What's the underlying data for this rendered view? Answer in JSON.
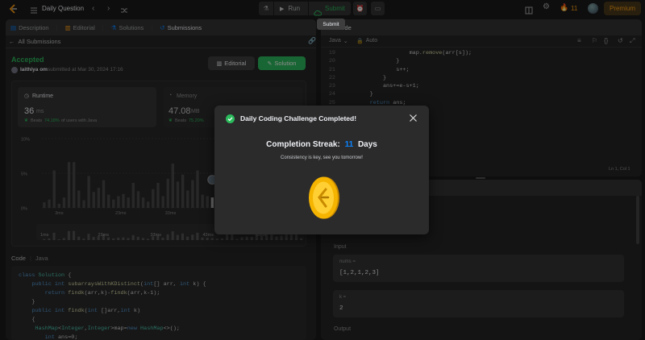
{
  "topbar": {
    "problem_list_label": "Daily Question",
    "run_label": "Run",
    "submit_label": "Submit",
    "streak_count": "11",
    "premium_label": "Premium",
    "tooltip": "Submit"
  },
  "left_tabs": [
    "Description",
    "Editorial",
    "Solutions",
    "Submissions"
  ],
  "submission": {
    "back_label": "All Submissions",
    "status": "Accepted",
    "user": "laithiya om",
    "submitted_text": "submitted at Mar 30, 2024 17:16",
    "editorial_btn": "Editorial",
    "solution_btn": "Solution",
    "runtime_label": "Runtime",
    "runtime_value": "36",
    "runtime_unit": "ms",
    "runtime_beats_prefix": "Beats",
    "runtime_beats_pct": "74.18%",
    "runtime_beats_suffix": "of users with Java",
    "memory_label": "Memory",
    "memory_value": "47.08",
    "memory_unit": "MB",
    "memory_beats_prefix": "Beats",
    "memory_beats_pct": "75.20%"
  },
  "chart_data": {
    "type": "bar",
    "ylabel_ticks": [
      "10%",
      "5%",
      "0%"
    ],
    "ylim": [
      0,
      10
    ],
    "x_ticks": [
      "3ms",
      "23ms",
      "33ms",
      "43ms"
    ],
    "mini_ticks": [
      "1ms",
      "23ms",
      "33ms",
      "43ms",
      "53ms"
    ],
    "values": [
      0.8,
      1.2,
      5.4,
      0.6,
      1.5,
      6.6,
      6.6,
      2.5,
      1.1,
      4.6,
      2.3,
      2.9,
      4.0,
      1.9,
      1.2,
      1.7,
      2.0,
      1.5,
      3.6,
      2.4,
      1.5,
      0.9,
      2.7,
      3.6,
      1.7,
      4.2,
      6.4,
      3.8,
      4.8,
      2.5,
      4.0,
      5.4,
      1.9,
      1.7,
      1.5,
      0.9,
      1.1,
      5.8,
      4.2,
      0.7,
      2.1,
      2.5,
      2.3,
      4.1,
      3.1,
      6.6,
      5.8,
      2.7,
      3.2,
      7.2,
      6.0,
      5.3,
      1.3
    ],
    "highlight_index": 34
  },
  "code_left": {
    "header": "Code",
    "lang": "Java",
    "lines": [
      "class Solution {",
      "    public int subarraysWithKDistinct(int[] arr, int k) {",
      "        return findk(arr,k)-findk(arr,k-1);",
      "    }",
      "    public int findk(int []arr,int k)",
      "    {",
      "     HashMap<Integer,Integer>map=new HashMap<>();",
      "        int ans=0;"
    ]
  },
  "editor": {
    "tab_label": "Code",
    "language": "Java",
    "auto_label": "Auto",
    "line_numbers": [
      "19",
      "20",
      "21",
      "22",
      "23",
      "24",
      "25",
      "26"
    ],
    "lines": [
      "                    map.remove(arr[s]);",
      "                }",
      "                s++;",
      "            }",
      "            ans+=e-s+1;",
      "        }",
      "        return ans;",
      "    }"
    ],
    "cursor_pos": "Ln 1, Col 1"
  },
  "testcase": {
    "input_label": "Input",
    "param1_name": "nums =",
    "param1_value": "[1,2,1,2,3]",
    "param2_name": "k =",
    "param2_value": "2",
    "output_label": "Output"
  },
  "modal": {
    "title": "Daily Coding Challenge Completed!",
    "streak_prefix": "Completion Streak:",
    "streak_value": "11",
    "streak_suffix": "Days",
    "subtitle": "Consistency is key, see you tomorrow!"
  },
  "colors": {
    "accent_green": "#2cbb5d",
    "accent_blue": "#0a84ff",
    "premium": "#ffa116",
    "coin": "#f5b400"
  }
}
